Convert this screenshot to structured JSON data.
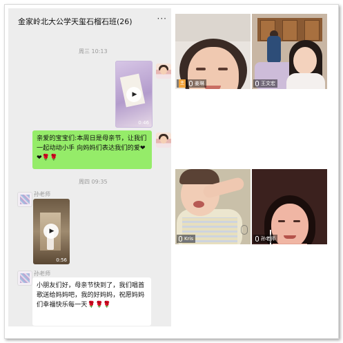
{
  "chat": {
    "title": "金家岭北大公学天玺石榴石班(26)",
    "more_icon": "···",
    "messages": [
      {
        "type": "timestamp",
        "text": "周三 10:13"
      },
      {
        "type": "video",
        "side": "right",
        "duration": "0:46"
      },
      {
        "type": "text",
        "side": "right",
        "text": "亲爱的宝宝们:本周日是母亲节，让我们一起动动小手 向妈妈们表达我们的爱❤❤🌹🌹"
      },
      {
        "type": "timestamp",
        "text": "周四 09:35"
      },
      {
        "type": "video",
        "side": "left",
        "sender": "孙老师",
        "duration": "0:56"
      },
      {
        "type": "text",
        "side": "left",
        "sender": "孙老师",
        "text": "小朋友们好，母亲节快到了，我们唱首歌送给妈妈吧，我的好妈妈，祝愿妈妈们幸福快乐每一天🌹🌹🌹"
      }
    ]
  },
  "video_call": {
    "participants": [
      {
        "name": "姜琳",
        "badge": "主"
      },
      {
        "name": "王文宏"
      },
      {
        "name": "Kris"
      },
      {
        "name": "孙老师"
      }
    ]
  }
}
